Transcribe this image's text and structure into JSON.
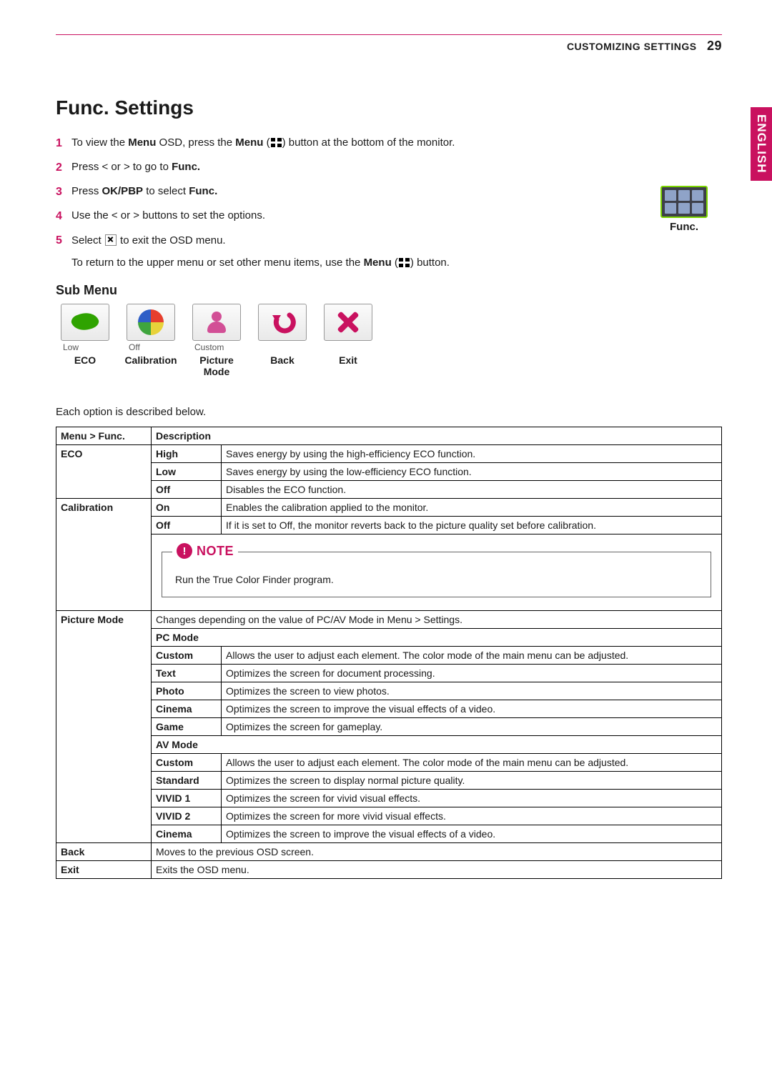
{
  "header": {
    "section": "CUSTOMIZING SETTINGS",
    "page": "29"
  },
  "language_tab": "ENGLISH",
  "title": "Func. Settings",
  "steps": {
    "s1a": "To view the ",
    "s1b": "Menu",
    "s1c": " OSD, press the ",
    "s1d": "Menu",
    "s1e": " button at the bottom of the monitor.",
    "s2a": "Press < or > to go to ",
    "s2b": "Func.",
    "s3a": "Press ",
    "s3b": "OK/PBP",
    "s3c": " to select ",
    "s3d": "Func.",
    "s4": "Use the < or > buttons to set the options.",
    "s5a": "Select ",
    "s5b": " to exit the OSD menu."
  },
  "return_a": "To return to the upper menu or set other menu items, use the ",
  "return_b": "Menu",
  "return_c": " button.",
  "func_label": "Func.",
  "subheading": "Sub Menu",
  "sub": {
    "eco_state": "Low",
    "eco": "ECO",
    "cal_state": "Off",
    "cal": "Calibration",
    "pic_state": "Custom",
    "pic1": "Picture",
    "pic2": "Mode",
    "back": "Back",
    "exit": "Exit"
  },
  "desc_line": "Each option is described below.",
  "th_menu": "Menu > Func.",
  "th_desc": "Description",
  "rows": {
    "eco": "ECO",
    "eco_high": "High",
    "eco_high_d": "Saves energy by using the high-efficiency ECO function.",
    "eco_low": "Low",
    "eco_low_d": "Saves energy by using the low-efficiency ECO function.",
    "eco_off": "Off",
    "eco_off_d": "Disables the ECO function.",
    "cal": "Calibration",
    "cal_on": "On",
    "cal_on_d": "Enables the calibration applied to the monitor.",
    "cal_off": "Off",
    "cal_off_d": "If it is set to Off, the monitor reverts back to the picture quality set before calibration.",
    "note_label": "NOTE",
    "note_body": "Run the True Color Finder program.",
    "pic": "Picture Mode",
    "pic_intro": "Changes depending on the value of PC/AV Mode in Menu > Settings.",
    "pc_mode": "PC Mode",
    "pc_custom": "Custom",
    "pc_custom_d": "Allows the user to adjust each element. The color mode of the main menu can be adjusted.",
    "pc_text": "Text",
    "pc_text_d": "Optimizes the screen for document processing.",
    "pc_photo": "Photo",
    "pc_photo_d": "Optimizes the screen to view photos.",
    "pc_cinema": "Cinema",
    "pc_cinema_d": "Optimizes the screen to improve the visual effects of a video.",
    "pc_game": "Game",
    "pc_game_d": "Optimizes the screen for gameplay.",
    "av_mode": "AV Mode",
    "av_custom": "Custom",
    "av_custom_d": "Allows the user to adjust each element. The color mode of the main menu can be adjusted.",
    "av_standard": "Standard",
    "av_standard_d": "Optimizes the screen to display normal picture quality.",
    "av_vivid1": "VIVID 1",
    "av_vivid1_d": "Optimizes the screen for vivid visual effects.",
    "av_vivid2": "VIVID 2",
    "av_vivid2_d": "Optimizes the screen for more vivid visual effects.",
    "av_cinema": "Cinema",
    "av_cinema_d": "Optimizes the screen to improve the visual effects of a video.",
    "back": "Back",
    "back_d": "Moves to the previous OSD screen.",
    "exit": "Exit",
    "exit_d": "Exits the OSD menu."
  }
}
